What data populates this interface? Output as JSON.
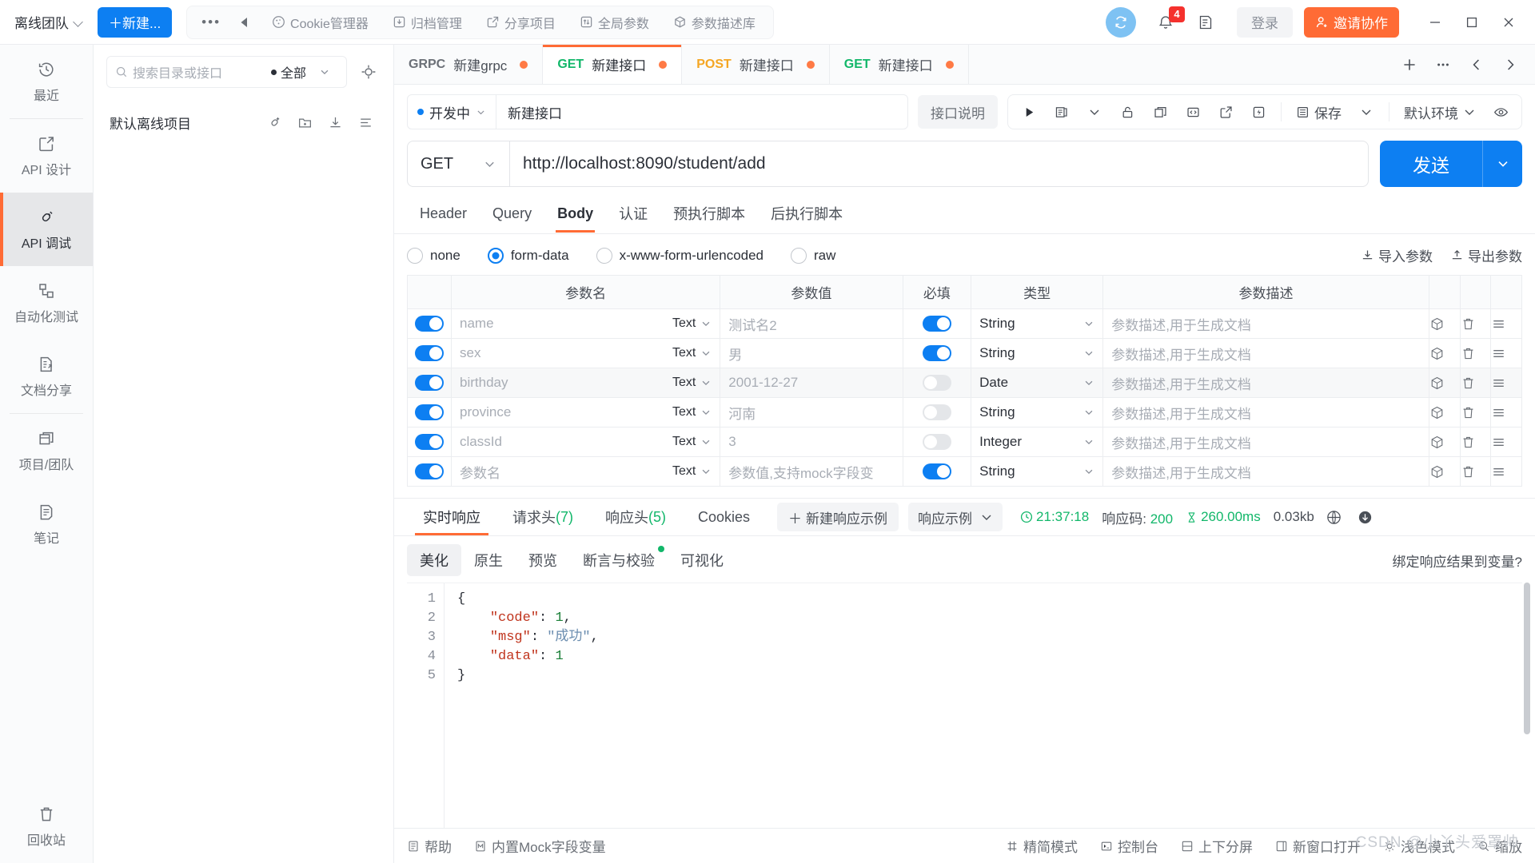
{
  "topbar": {
    "team": "离线团队",
    "new_button": "＋新建...",
    "tools": [
      {
        "label": "Cookie管理器",
        "icon": "cookie-icon"
      },
      {
        "label": "归档管理",
        "icon": "archive-icon"
      },
      {
        "label": "分享项目",
        "icon": "share-icon"
      },
      {
        "label": "全局参数",
        "icon": "updown-icon"
      },
      {
        "label": "参数描述库",
        "icon": "cube-icon"
      }
    ],
    "notification_count": "4",
    "login_label": "登录",
    "invite_label": "邀请协作"
  },
  "rail": {
    "items": [
      {
        "label": "最近",
        "icon": "history-icon",
        "active": false
      },
      {
        "label": "API 设计",
        "icon": "pencil-square-icon",
        "active": false
      },
      {
        "label": "API 调试",
        "icon": "plug-icon",
        "active": true
      },
      {
        "label": "自动化测试",
        "icon": "flow-icon",
        "active": false
      },
      {
        "label": "文档分享",
        "icon": "doc-share-icon",
        "active": false
      },
      {
        "label": "项目/团队",
        "icon": "copy-icon",
        "active": false
      },
      {
        "label": "笔记",
        "icon": "note-icon",
        "active": false
      }
    ],
    "bottom": {
      "label": "回收站",
      "icon": "trash-icon"
    }
  },
  "tree": {
    "search_placeholder": "搜索目录或接口",
    "filter_label": "全部",
    "project_name": "默认离线项目",
    "actions": [
      "add-api-icon",
      "add-folder-icon",
      "download-icon",
      "sort-icon"
    ]
  },
  "tabs": [
    {
      "method": "GRPC",
      "title": "新建grpc",
      "dirty": true,
      "active": false
    },
    {
      "method": "GET",
      "title": "新建接口",
      "dirty": true,
      "active": true
    },
    {
      "method": "POST",
      "title": "新建接口",
      "dirty": true,
      "active": false
    },
    {
      "method": "GET",
      "title": "新建接口",
      "dirty": true,
      "active": false
    }
  ],
  "tab_actions": [
    "plus-icon",
    "more-icon",
    "chevron-left-icon",
    "chevron-right-icon"
  ],
  "request": {
    "status_label": "开发中",
    "name": "新建接口",
    "doc_button": "接口说明",
    "save_label": "保存",
    "env_label": "默认环境",
    "method": "GET",
    "url": "http://localhost:8090/student/add",
    "send_label": "发送",
    "param_tabs": [
      {
        "label": "Header",
        "active": false
      },
      {
        "label": "Query",
        "active": false
      },
      {
        "label": "Body",
        "active": true
      },
      {
        "label": "认证",
        "active": false
      },
      {
        "label": "预执行脚本",
        "active": false
      },
      {
        "label": "后执行脚本",
        "active": false
      }
    ],
    "body_types": [
      {
        "label": "none",
        "selected": false
      },
      {
        "label": "form-data",
        "selected": true
      },
      {
        "label": "x-www-form-urlencoded",
        "selected": false
      },
      {
        "label": "raw",
        "selected": false
      }
    ],
    "import_label": "导入参数",
    "export_label": "导出参数"
  },
  "table": {
    "headers": [
      "",
      "参数名",
      "参数值",
      "必填",
      "类型",
      "参数描述",
      ""
    ],
    "desc_placeholder": "参数描述,用于生成文档",
    "rows": [
      {
        "enabled": true,
        "name": "name",
        "kind": "Text",
        "value": "测试名2",
        "required": true,
        "type": "String",
        "desc": "",
        "alt": false
      },
      {
        "enabled": true,
        "name": "sex",
        "kind": "Text",
        "value": "男",
        "required": true,
        "type": "String",
        "desc": "",
        "alt": false
      },
      {
        "enabled": true,
        "name": "birthday",
        "kind": "Text",
        "value": "2001-12-27",
        "required": false,
        "type": "Date",
        "desc": "",
        "alt": true
      },
      {
        "enabled": true,
        "name": "province",
        "kind": "Text",
        "value": "河南",
        "required": false,
        "type": "String",
        "desc": "",
        "alt": false
      },
      {
        "enabled": true,
        "name": "classId",
        "kind": "Text",
        "value": "3",
        "required": false,
        "type": "Integer",
        "desc": "",
        "alt": false
      },
      {
        "enabled": true,
        "name": "参数名",
        "kind": "Text",
        "value": "参数值,支持mock字段变",
        "required": true,
        "type": "String",
        "desc": "",
        "alt": false
      }
    ]
  },
  "response": {
    "tabs": [
      {
        "label": "实时响应",
        "count": "",
        "active": true
      },
      {
        "label": "请求头",
        "count": "(7)",
        "active": false
      },
      {
        "label": "响应头",
        "count": "(5)",
        "active": false
      },
      {
        "label": "Cookies",
        "count": "",
        "active": false
      }
    ],
    "new_example_label": "新建响应示例",
    "example_select": "响应示例",
    "time": "21:37:18",
    "code_label": "响应码:",
    "code_value": "200",
    "duration": "260.00ms",
    "size": "0.03kb",
    "viewer_tabs": [
      {
        "label": "美化",
        "active": true,
        "dot": false
      },
      {
        "label": "原生",
        "active": false,
        "dot": false
      },
      {
        "label": "预览",
        "active": false,
        "dot": false
      },
      {
        "label": "断言与校验",
        "active": false,
        "dot": true
      },
      {
        "label": "可视化",
        "active": false,
        "dot": false
      }
    ],
    "bind_link": "绑定响应结果到变量?",
    "line_numbers": [
      "1",
      "2",
      "3",
      "4",
      "5"
    ],
    "json": {
      "code_key": "\"code\"",
      "code_val": "1",
      "msg_key": "\"msg\"",
      "msg_val": "\"成功\"",
      "data_key": "\"data\"",
      "data_val": "1"
    }
  },
  "bottombar": {
    "left": [
      {
        "label": "帮助",
        "icon": "help-icon"
      },
      {
        "label": "内置Mock字段变量",
        "icon": "mock-icon"
      }
    ],
    "right": [
      {
        "label": "精简模式",
        "icon": "compact-icon"
      },
      {
        "label": "控制台",
        "icon": "console-icon"
      },
      {
        "label": "上下分屏",
        "icon": "split-icon"
      },
      {
        "label": "新窗口打开",
        "icon": "window-icon"
      },
      {
        "label": "浅色模式",
        "icon": "sun-icon"
      },
      {
        "label": "缩放",
        "icon": "zoom-icon"
      }
    ]
  },
  "watermark": "CSDN @小丫头爱罩帅"
}
